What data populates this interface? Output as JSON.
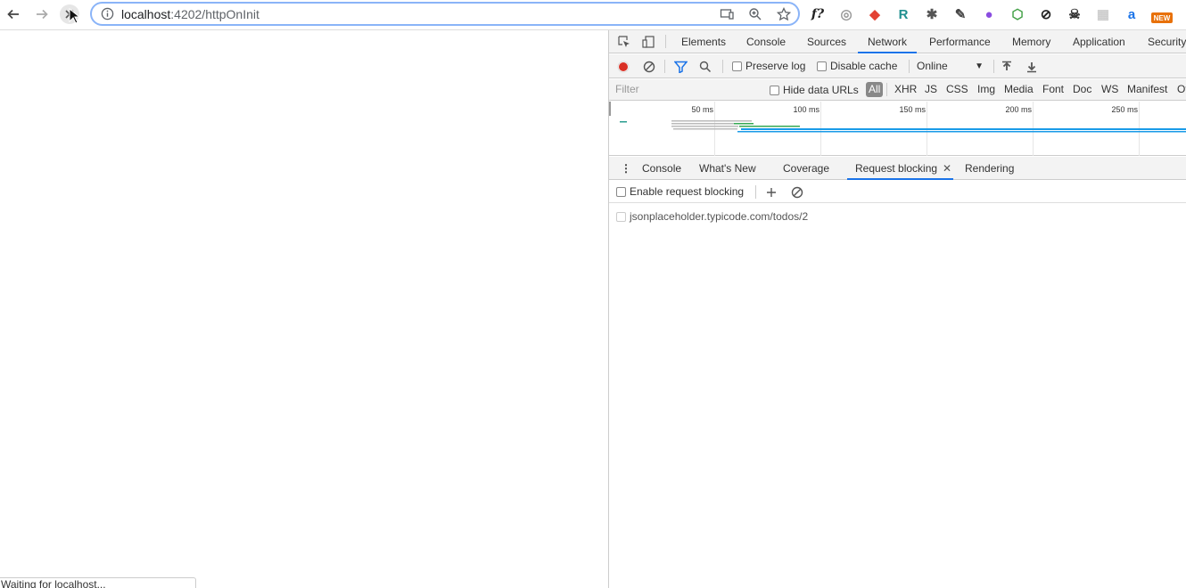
{
  "browser": {
    "url_host": "localhost",
    "url_path": ":4202/httpOnInit",
    "extensions": [
      {
        "name": "function-icon",
        "glyph": "f?",
        "color": "#222222"
      },
      {
        "name": "spiral-icon",
        "glyph": "◎",
        "color": "#999999"
      },
      {
        "name": "color-wheel-icon",
        "glyph": "◆",
        "color": "#e34234"
      },
      {
        "name": "react-icon",
        "glyph": "R",
        "color": "#1f8f8f"
      },
      {
        "name": "bug-icon",
        "glyph": "✱",
        "color": "#555555"
      },
      {
        "name": "eyedropper-icon",
        "glyph": "✎",
        "color": "#444444"
      },
      {
        "name": "redux-icon",
        "glyph": "●",
        "color": "#8a4de0"
      },
      {
        "name": "nodejs-icon",
        "glyph": "⬡",
        "color": "#43a047"
      },
      {
        "name": "slash-circle-icon",
        "glyph": "⊘",
        "color": "#222222"
      },
      {
        "name": "skull-icon",
        "glyph": "☠",
        "color": "#333333"
      },
      {
        "name": "grid-icon",
        "glyph": "▦",
        "color": "#cccccc"
      },
      {
        "name": "translate-icon",
        "glyph": "a",
        "color": "#1a73e8"
      },
      {
        "name": "new-extension-icon",
        "glyph": "NEW",
        "color": "#e8710a"
      }
    ]
  },
  "page": {
    "status": "Waiting for localhost..."
  },
  "devtools": {
    "tabs": [
      "Elements",
      "Console",
      "Sources",
      "Network",
      "Performance",
      "Memory",
      "Application",
      "Security"
    ],
    "active_tab": "Network",
    "toolbar": {
      "preserve_log": "Preserve log",
      "disable_cache": "Disable cache",
      "throttling": "Online"
    },
    "filter": {
      "placeholder": "Filter",
      "hide_data_urls": "Hide data URLs",
      "types": [
        "All",
        "XHR",
        "JS",
        "CSS",
        "Img",
        "Media",
        "Font",
        "Doc",
        "WS",
        "Manifest",
        "Ot"
      ]
    },
    "overview_ticks": [
      "50 ms",
      "100 ms",
      "150 ms",
      "200 ms",
      "250 ms"
    ],
    "drawer": {
      "tabs": [
        "Console",
        "What's New",
        "Coverage",
        "Request blocking",
        "Rendering"
      ],
      "active_tab": "Request blocking",
      "enable_label": "Enable request blocking",
      "patterns": [
        "jsonplaceholder.typicode.com/todos/2"
      ]
    }
  },
  "colors": {
    "accent": "#1a73e8",
    "record": "#d93025",
    "filter_icon": "#1a73e8"
  }
}
